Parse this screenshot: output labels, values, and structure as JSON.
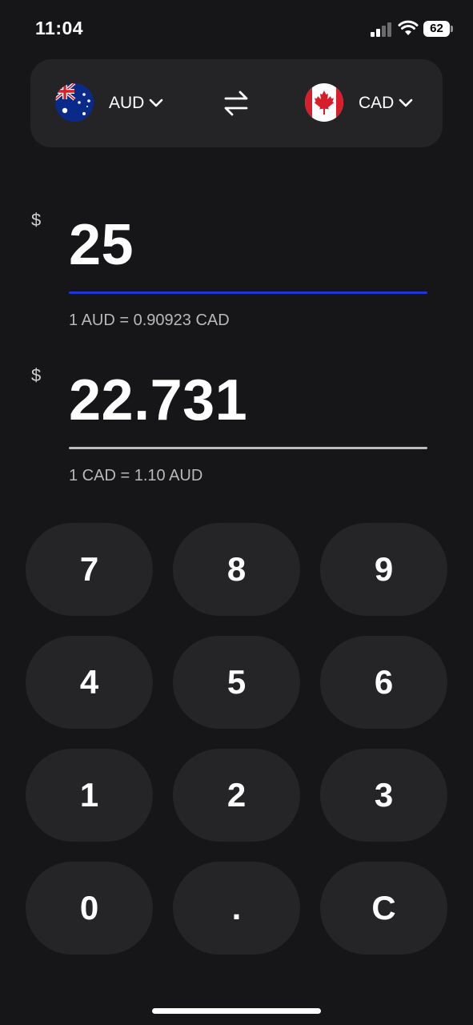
{
  "status_bar": {
    "time": "11:04",
    "battery_level": "62",
    "icons": [
      "cellular-signal-icon",
      "wifi-icon",
      "battery-icon"
    ]
  },
  "converter": {
    "from": {
      "code": "AUD",
      "flag_icon": "australia-flag-icon"
    },
    "to": {
      "code": "CAD",
      "flag_icon": "canada-flag-icon"
    },
    "swap_icon": "swap-arrows-icon"
  },
  "input_amount": {
    "symbol": "$",
    "value": "25",
    "rate_text": "1 AUD = 0.90923 CAD",
    "active": true
  },
  "output_amount": {
    "symbol": "$",
    "value": "22.731",
    "rate_text": "1 CAD = 1.10 AUD",
    "active": false
  },
  "keypad": {
    "keys": [
      "7",
      "8",
      "9",
      "4",
      "5",
      "6",
      "1",
      "2",
      "3",
      "0",
      ".",
      "C"
    ]
  },
  "colors": {
    "background": "#161618",
    "card": "#242427",
    "key": "#252528",
    "active_underline": "#1f36d6",
    "inactive_underline": "#bdbdc1"
  }
}
